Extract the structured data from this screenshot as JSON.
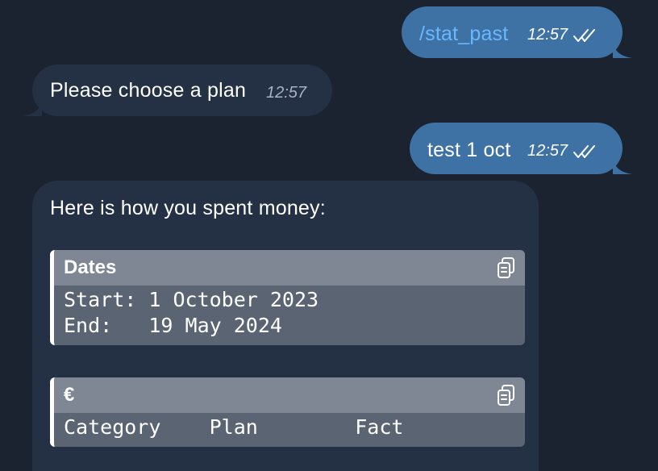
{
  "messages": {
    "m1": {
      "text": "/stat_past",
      "time": "12:57"
    },
    "m2": {
      "text": "Please choose a plan",
      "time": "12:57"
    },
    "m3": {
      "text": "test 1 oct",
      "time": "12:57"
    },
    "m4": {
      "intro": "Here is how you spent money:",
      "block1": {
        "title": "Dates",
        "line1": "Start: 1 October 2023",
        "line2": "End:   19 May 2024"
      },
      "block2": {
        "title": "€",
        "line1": "Category    Plan        Fact"
      }
    }
  },
  "colors": {
    "background": "#1b2230",
    "outgoing_bubble": "#3f72a4",
    "incoming_bubble": "#243144",
    "command_link": "#69b8ff"
  },
  "icons": [
    "double-check-icon",
    "copy-icon"
  ]
}
